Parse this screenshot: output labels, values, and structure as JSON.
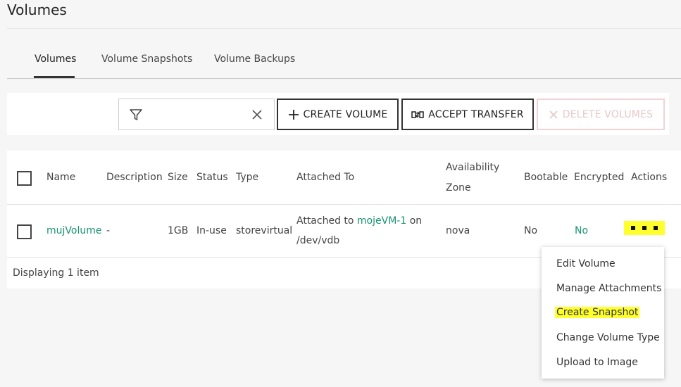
{
  "page": {
    "title": "Volumes"
  },
  "tabs": [
    {
      "label": "Volumes",
      "active": true
    },
    {
      "label": "Volume Snapshots",
      "active": false
    },
    {
      "label": "Volume Backups",
      "active": false
    }
  ],
  "toolbar": {
    "filter_value": "",
    "create_label": "CREATE VOLUME",
    "accept_label": "ACCEPT TRANSFER",
    "delete_label": "DELETE VOLUMES"
  },
  "table": {
    "headers": {
      "name": "Name",
      "description": "Description",
      "size": "Size",
      "status": "Status",
      "type": "Type",
      "attached_to": "Attached To",
      "availability_zone_line1": "Availability",
      "availability_zone_line2": "Zone",
      "bootable": "Bootable",
      "encrypted": "Encrypted",
      "actions": "Actions"
    },
    "rows": [
      {
        "name": "mujVolume",
        "description": "-",
        "size": "1GB",
        "status": "In-use",
        "type": "storevirtual",
        "attached_prefix": "Attached to",
        "attached_vm": "mojeVM-1",
        "attached_suffix": "on",
        "attached_device": "/dev/vdb",
        "availability_zone": "nova",
        "bootable": "No",
        "encrypted": "No"
      }
    ],
    "footer": "Displaying 1 item"
  },
  "actions_menu": {
    "items": [
      "Edit Volume",
      "Manage Attachments",
      "Create Snapshot",
      "Change Volume Type",
      "Upload to Image"
    ],
    "highlight_color": "#ffff2e"
  },
  "colors": {
    "link": "#1a9470",
    "border_dark": "#333333",
    "delete_disabled_border": "#f3d3d6"
  },
  "icons": [
    "filter-icon",
    "close-icon",
    "plus-icon",
    "transfer-icon",
    "delete-x-icon",
    "more-actions-icon"
  ]
}
